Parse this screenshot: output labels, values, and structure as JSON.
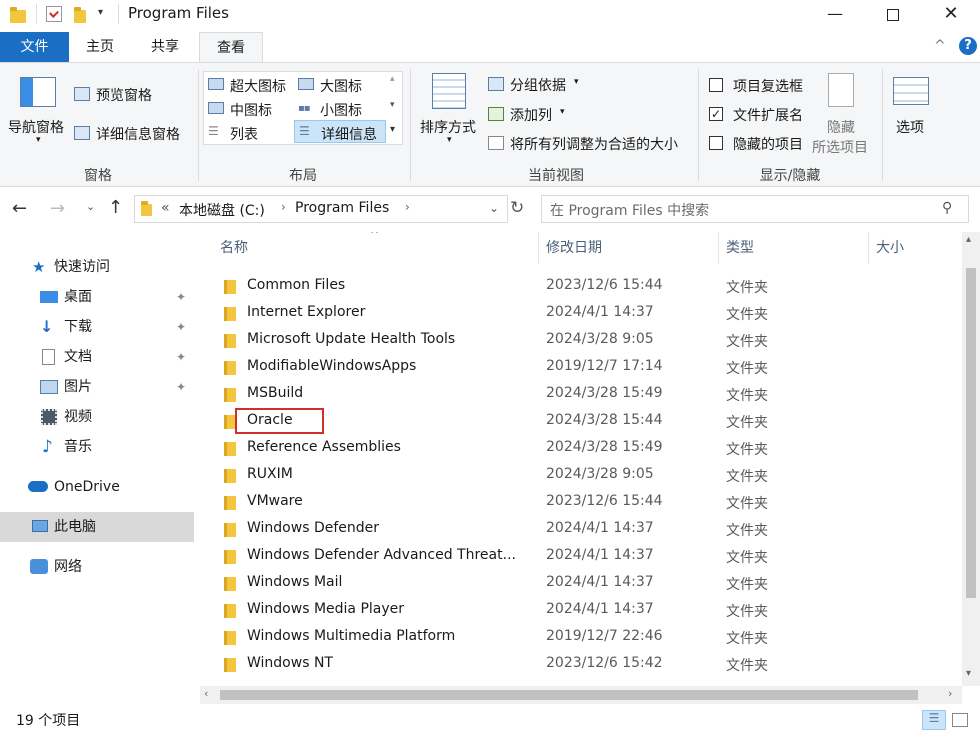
{
  "window": {
    "title": "Program Files"
  },
  "tabs": {
    "file": "文件",
    "home": "主页",
    "share": "共享",
    "view": "查看"
  },
  "ribbon": {
    "panes": {
      "nav_pane": "导航窗格",
      "preview_pane": "预览窗格",
      "details_pane": "详细信息窗格",
      "group": "窗格"
    },
    "layout": {
      "extra_large": "超大图标",
      "large": "大图标",
      "medium": "中图标",
      "small": "小图标",
      "list": "列表",
      "details": "详细信息",
      "group": "布局",
      "selected": "详细信息"
    },
    "current_view": {
      "sort_by": "排序方式",
      "group_by": "分组依据",
      "add_columns": "添加列",
      "fit_columns": "将所有列调整为合适的大小",
      "group": "当前视图"
    },
    "show_hide": {
      "item_checkboxes": "项目复选框",
      "file_extensions": "文件扩展名",
      "hidden_items": "隐藏的项目",
      "item_checkboxes_checked": false,
      "file_extensions_checked": true,
      "hidden_items_checked": false,
      "hide_selected_1": "隐藏",
      "hide_selected_2": "所选项目",
      "group": "显示/隐藏"
    },
    "options": "选项"
  },
  "address": {
    "prefix": "«",
    "crumb1": "本地磁盘 (C:)",
    "crumb2": "Program Files",
    "search_placeholder": "在 Program Files 中搜索"
  },
  "nav": {
    "quick_access": "快速访问",
    "desktop": "桌面",
    "downloads": "下载",
    "documents": "文档",
    "pictures": "图片",
    "videos": "视频",
    "music": "音乐",
    "onedrive": "OneDrive",
    "this_pc": "此电脑",
    "network": "网络"
  },
  "columns": {
    "name": "名称",
    "modified": "修改日期",
    "type": "类型",
    "size": "大小"
  },
  "files": [
    {
      "name": "Common Files",
      "date": "2023/12/6 15:44",
      "type": "文件夹"
    },
    {
      "name": "Internet Explorer",
      "date": "2024/4/1 14:37",
      "type": "文件夹"
    },
    {
      "name": "Microsoft Update Health Tools",
      "date": "2024/3/28 9:05",
      "type": "文件夹"
    },
    {
      "name": "ModifiableWindowsApps",
      "date": "2019/12/7 17:14",
      "type": "文件夹"
    },
    {
      "name": "MSBuild",
      "date": "2024/3/28 15:49",
      "type": "文件夹"
    },
    {
      "name": "Oracle",
      "date": "2024/3/28 15:44",
      "type": "文件夹"
    },
    {
      "name": "Reference Assemblies",
      "date": "2024/3/28 15:49",
      "type": "文件夹"
    },
    {
      "name": "RUXIM",
      "date": "2024/3/28 9:05",
      "type": "文件夹"
    },
    {
      "name": "VMware",
      "date": "2023/12/6 15:44",
      "type": "文件夹"
    },
    {
      "name": "Windows Defender",
      "date": "2024/4/1 14:37",
      "type": "文件夹"
    },
    {
      "name": "Windows Defender Advanced Threat...",
      "date": "2024/4/1 14:37",
      "type": "文件夹"
    },
    {
      "name": "Windows Mail",
      "date": "2024/4/1 14:37",
      "type": "文件夹"
    },
    {
      "name": "Windows Media Player",
      "date": "2024/4/1 14:37",
      "type": "文件夹"
    },
    {
      "name": "Windows Multimedia Platform",
      "date": "2019/12/7 22:46",
      "type": "文件夹"
    },
    {
      "name": "Windows NT",
      "date": "2023/12/6 15:42",
      "type": "文件夹"
    }
  ],
  "status": {
    "count": "19 个项目"
  },
  "colors": {
    "accent": "#1a6fc4",
    "highlight_box": "#d0302b",
    "folder": "#f3c63f"
  }
}
